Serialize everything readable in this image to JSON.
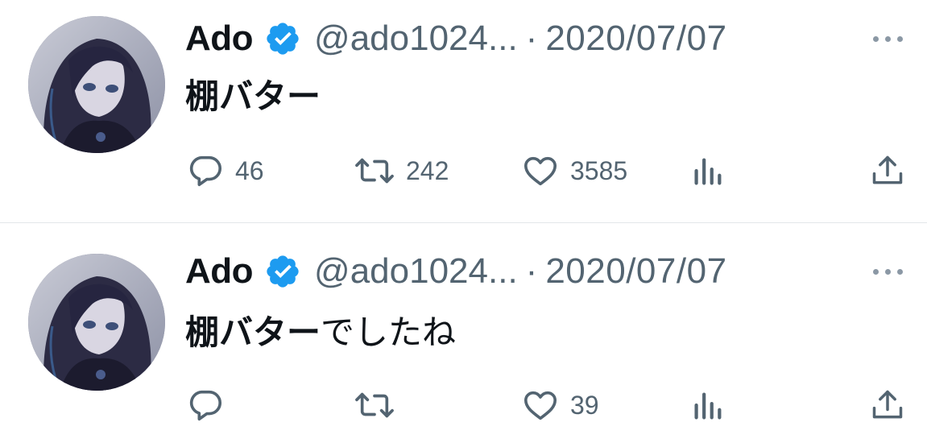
{
  "tweets": [
    {
      "name": "Ado",
      "handle": "@ado1024...",
      "separator": "·",
      "date": "2020/07/07",
      "text_bold": "棚バター",
      "text_rest": "",
      "replies": "46",
      "retweets": "242",
      "likes": "3585",
      "views": ""
    },
    {
      "name": "Ado",
      "handle": "@ado1024...",
      "separator": "·",
      "date": "2020/07/07",
      "text_bold": "棚バター",
      "text_rest": "でしたね",
      "replies": "",
      "retweets": "",
      "likes": "39",
      "views": ""
    }
  ],
  "colors": {
    "text": "#0f1419",
    "secondary": "#536471",
    "verified": "#1d9bf0",
    "divider": "#e3e6e9"
  },
  "icons": [
    "verified-badge-icon",
    "more-icon",
    "reply-icon",
    "retweet-icon",
    "like-icon",
    "views-icon",
    "share-icon"
  ]
}
